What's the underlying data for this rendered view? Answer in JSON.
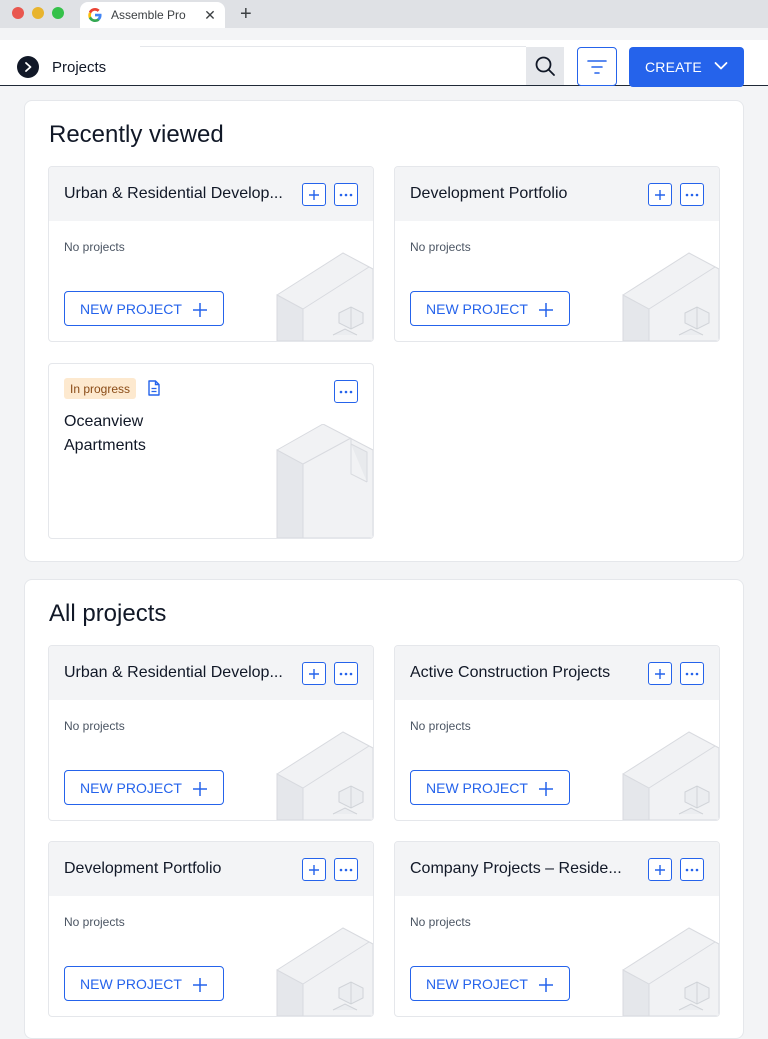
{
  "browser": {
    "tab_title": "Assemble Pro",
    "tab_close": "✕",
    "new_tab": "+"
  },
  "header": {
    "breadcrumb": "Projects",
    "create_label": "CREATE"
  },
  "recently_viewed": {
    "title": "Recently viewed",
    "cards": [
      {
        "title": "Urban & Residential Develop...",
        "empty_text": "No projects",
        "new_project_label": "NEW PROJECT"
      },
      {
        "title": "Development Portfolio",
        "empty_text": "No projects",
        "new_project_label": "NEW PROJECT"
      }
    ],
    "project_card": {
      "status": "In progress",
      "name": "Oceanview Apartments"
    }
  },
  "all_projects": {
    "title": "All projects",
    "cards": [
      {
        "title": "Urban & Residential Develop...",
        "empty_text": "No projects",
        "new_project_label": "NEW PROJECT"
      },
      {
        "title": "Active Construction Projects",
        "empty_text": "No projects",
        "new_project_label": "NEW PROJECT"
      },
      {
        "title": "Development Portfolio",
        "empty_text": "No projects",
        "new_project_label": "NEW PROJECT"
      },
      {
        "title": "Company Projects – Reside...",
        "empty_text": "No projects",
        "new_project_label": "NEW PROJECT"
      }
    ]
  },
  "icons": {
    "brand": "chevron-right-circle-icon",
    "search": "search-icon",
    "filter": "filter-icon",
    "add": "plus-icon",
    "more": "ellipsis-icon",
    "document": "document-icon"
  },
  "colors": {
    "accent": "#2563eb",
    "badge_bg": "#fde9cf",
    "badge_text": "#8a4b16"
  }
}
